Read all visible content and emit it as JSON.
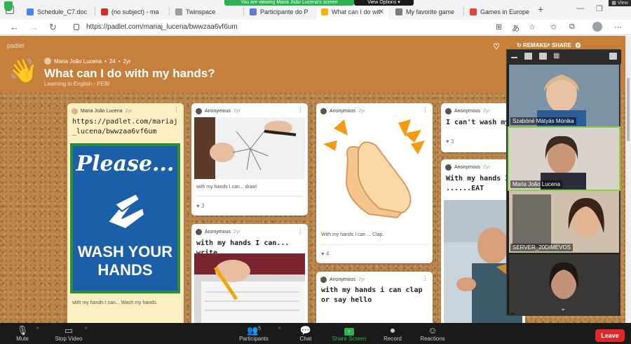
{
  "browser": {
    "tabs": [
      {
        "label": "Schedule_C7.doc",
        "color": "#4285f4"
      },
      {
        "label": "(no subject) - ma",
        "color": "#d93025"
      },
      {
        "label": "Twinspace",
        "color": "#9c9c9c"
      },
      {
        "label": "Participante do P",
        "color": "#5b7bd5"
      },
      {
        "label": "What can I do wit",
        "color": "#f4b400"
      },
      {
        "label": "My favorite game",
        "color": "#7b7b7b"
      },
      {
        "label": "Games in Europe",
        "color": "#ea4335"
      }
    ],
    "url": "https://padlet.com/mariaj_lucena/bwwzaa6vf6um",
    "new_tab": "+"
  },
  "screen_share": {
    "banner": "You are viewing Maria João Lucena's screen",
    "view_options": "View Options ▾",
    "view_label": "View"
  },
  "padlet": {
    "logo": "padlet",
    "owner": "Maria João Lucena",
    "likes_count": "24",
    "age": "2yr",
    "title": "What can I do with my hands?",
    "subtitle": "Learning in English - PEBI",
    "remake": "REMAKE",
    "share": "SHARE",
    "hero_emoji": "👋"
  },
  "cards": [
    {
      "author": "Maria João Lucena",
      "ago": "2yr",
      "text": "https://padlet.com/mariaj_lucena/bwwzaa6vf6um",
      "sign_top": "Please...",
      "sign_bottom": "WASH YOUR HANDS",
      "caption": "with my hands I can... Wash my hands."
    },
    {
      "author": "Anonymous",
      "ago": "2yr",
      "caption": "with my hands I can... draw!",
      "likes": "3"
    },
    {
      "author": "Anonymous",
      "ago": "2yr",
      "text": "with my hands I can... write"
    },
    {
      "author": "Anonymous",
      "ago": "2yr",
      "emoji": "👏",
      "caption": "With my hands I can ... Clap.",
      "likes": "4"
    },
    {
      "author": "Anonymous",
      "ago": "2yr",
      "text": "with my hands i can clap or say hello"
    },
    {
      "author": "Anonymous",
      "ago": "2yr",
      "text": "I can't wash my",
      "likes": "3"
    },
    {
      "author": "Anonymous",
      "ago": "2yr",
      "text": "With my hands I ......EAT"
    }
  ],
  "participants": [
    {
      "name": "Szabóné Mátyás Mónika"
    },
    {
      "name": "Maria João Lucena"
    },
    {
      "name": "SERVER_20DIMEVOS"
    },
    {
      "name": ""
    }
  ],
  "zoom_toolbar": {
    "mute": "Mute",
    "stop_video": "Stop Video",
    "participants": "Participants",
    "participants_count": "5",
    "chat": "Chat",
    "share_screen": "Share Screen",
    "record": "Record",
    "reactions": "Reactions",
    "leave": "Leave"
  }
}
